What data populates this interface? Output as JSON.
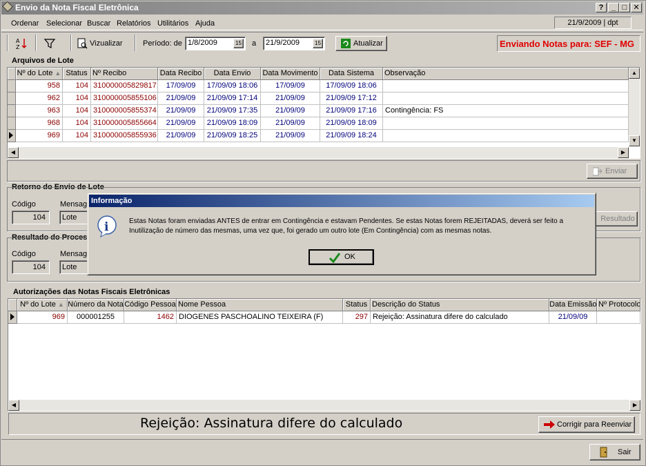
{
  "window": {
    "title": "Envio da Nota Fiscal Eletrônica",
    "help_btn": "?",
    "min_btn": "_",
    "max_btn": "□",
    "close_btn": "✕"
  },
  "menu": [
    "Ordenar",
    "Selecionar",
    "Buscar",
    "Relatórios",
    "Utilitários",
    "Ajuda"
  ],
  "status_date": "21/9/2009 | dpt",
  "toolbar": {
    "visualizar": "Vizualizar",
    "periodo_label": "Período: de",
    "date_from": "1/8/2009",
    "a_label": "a",
    "date_to": "21/9/2009",
    "atualizar": "Atualizar",
    "sending": "Enviando Notas para: SEF - MG"
  },
  "lote": {
    "title": "Arquivos de Lote",
    "headers": [
      "Nº do Lote",
      "Status",
      "Nº Recibo",
      "Data Recibo",
      "Data Envio",
      "Data Movimento",
      "Data Sistema",
      "Observação"
    ],
    "rows": [
      [
        "958",
        "104",
        "310000005829817",
        "17/09/09",
        "17/09/09 18:06",
        "17/09/09",
        "17/09/09 18:06",
        ""
      ],
      [
        "962",
        "104",
        "310000005855106",
        "21/09/09",
        "21/09/09 17:14",
        "21/09/09",
        "21/09/09 17:12",
        ""
      ],
      [
        "963",
        "104",
        "310000005855374",
        "21/09/09",
        "21/09/09 17:35",
        "21/09/09",
        "21/09/09 17:16",
        "Contingência: FS"
      ],
      [
        "968",
        "104",
        "310000005855664",
        "21/09/09",
        "21/09/09 18:09",
        "21/09/09",
        "21/09/09 18:09",
        ""
      ],
      [
        "969",
        "104",
        "310000005855936",
        "21/09/09",
        "21/09/09 18:25",
        "21/09/09",
        "21/09/09 18:24",
        ""
      ]
    ],
    "enviar": "Enviar"
  },
  "retorno": {
    "title": "Retorno do Envio de Lote",
    "codigo_label": "Código",
    "codigo": "104",
    "mensagem_label": "Mensagem",
    "mensagem": "Lote pro",
    "resultado_btn": "Resultado"
  },
  "resultado": {
    "title": "Resultado do Processamento",
    "codigo_label": "Código",
    "codigo": "104",
    "mensagem_label": "Mensagem",
    "mensagem": "Lote pro"
  },
  "autoriz": {
    "title": "Autorizações das Notas Fiscais Eletrônicas",
    "headers": [
      "Nº do Lote",
      "Número da Nota",
      "Código Pessoa",
      "Nome Pessoa",
      "Status",
      "Descrição do Status",
      "Data Emissão",
      "Nº Protocolo"
    ],
    "rows": [
      [
        "969",
        "000001255",
        "1462",
        "DIOGENES PASCHOALINO TEIXEIRA (F)",
        "297",
        "Rejeição: Assinatura difere do calculado",
        "21/09/09",
        ""
      ]
    ],
    "message": "Rejeição: Assinatura difere do calculado",
    "corrigir": "Corrigir para Reenviar"
  },
  "sair": "Sair",
  "dialog": {
    "title": "Informação",
    "text": "Estas Notas foram enviadas ANTES de entrar em Contingência e estavam Pendentes. Se estas Notas forem REJEITADAS, deverá ser feito a Inutilização de número das mesmas, uma vez que, foi gerado um outro lote (Em Contingência) com as mesmas notas.",
    "ok": "OK"
  }
}
